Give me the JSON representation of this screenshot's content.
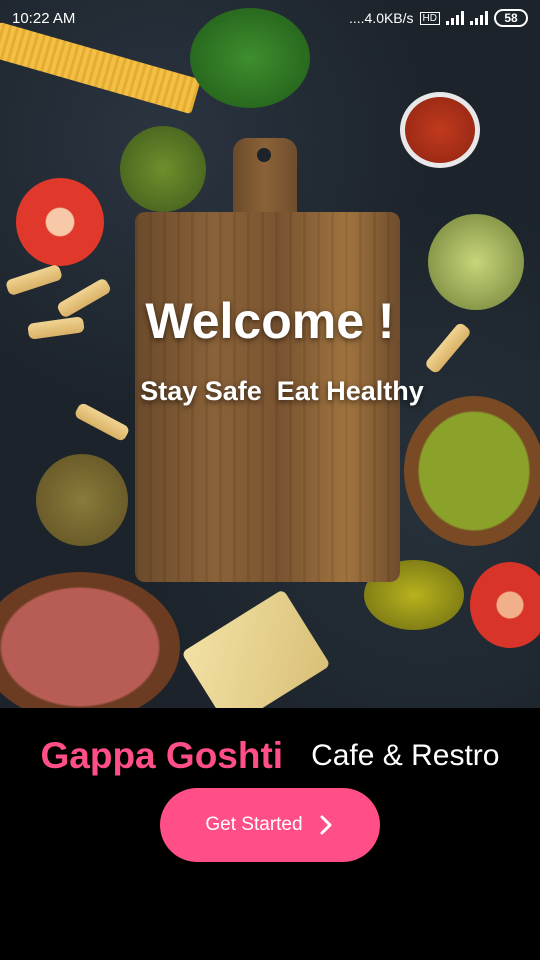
{
  "status_bar": {
    "time": "10:22 AM",
    "network_speed": "....4.0KB/s",
    "battery": "58",
    "icons": [
      "network-speed-icon",
      "volte-icon",
      "signal-icon",
      "signal-icon",
      "battery-icon"
    ]
  },
  "hero": {
    "image_icon": "food-ingredients-background-image",
    "title": "Welcome !",
    "tagline": "Stay Safe  Eat Healthy"
  },
  "brand": {
    "name": "Gappa Goshti",
    "subtitle": "Cafe & Restro"
  },
  "cta": {
    "label": "Get Started",
    "icon": "chevron-right-icon"
  },
  "colors": {
    "accent": "#ff4f86",
    "background": "#000000",
    "text": "#ffffff"
  }
}
